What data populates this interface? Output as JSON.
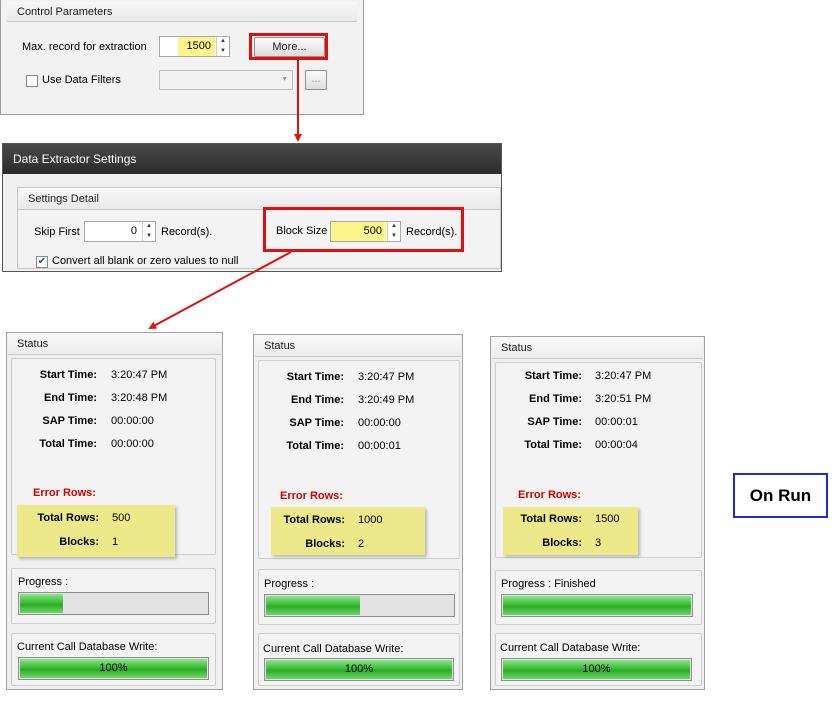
{
  "control_parameters": {
    "header": "Control Parameters",
    "max_record_label": "Max. record for extraction",
    "max_record_value": "1500",
    "more_button": "More...",
    "use_filters_label": "Use Data Filters",
    "use_filters_checked": false,
    "filter_button": "..."
  },
  "data_extractor_settings": {
    "title": "Data Extractor Settings",
    "group_header": "Settings Detail",
    "skip_first_label": "Skip First",
    "skip_first_value": "0",
    "skip_records_label": "Record(s).",
    "block_size_label": "Block Size",
    "block_size_value": "500",
    "block_records_label": "Record(s).",
    "convert_label": "Convert all blank or zero values to null",
    "convert_checked": true
  },
  "status_panels": [
    {
      "header": "Status",
      "start_time_label": "Start Time:",
      "start_time": "3:20:47 PM",
      "end_time_label": "End Time:",
      "end_time": "3:20:48 PM",
      "sap_time_label": "SAP Time:",
      "sap_time": "00:00:00",
      "total_time_label": "Total Time:",
      "total_time": "00:00:00",
      "error_rows_label": "Error Rows:",
      "total_rows_label": "Total Rows:",
      "total_rows": "500",
      "blocks_label": "Blocks:",
      "blocks": "1",
      "progress_label": "Progress :",
      "progress_status": "",
      "progress_fraction": 0.24,
      "db_write_label": "Current Call Database Write:",
      "db_write_value": "100%",
      "db_write_fraction": 1.0
    },
    {
      "header": "Status",
      "start_time_label": "Start Time:",
      "start_time": "3:20:47 PM",
      "end_time_label": "End Time:",
      "end_time": "3:20:49 PM",
      "sap_time_label": "SAP Time:",
      "sap_time": "00:00:00",
      "total_time_label": "Total Time:",
      "total_time": "00:00:01",
      "error_rows_label": "Error Rows:",
      "total_rows_label": "Total Rows:",
      "total_rows": "1000",
      "blocks_label": "Blocks:",
      "blocks": "2",
      "progress_label": "Progress :",
      "progress_status": "",
      "progress_fraction": 0.51,
      "db_write_label": "Current Call Database Write:",
      "db_write_value": "100%",
      "db_write_fraction": 1.0
    },
    {
      "header": "Status",
      "start_time_label": "Start Time:",
      "start_time": "3:20:47 PM",
      "end_time_label": "End Time:",
      "end_time": "3:20:51 PM",
      "sap_time_label": "SAP Time:",
      "sap_time": "00:00:01",
      "total_time_label": "Total Time:",
      "total_time": "00:00:04",
      "error_rows_label": "Error Rows:",
      "total_rows_label": "Total Rows:",
      "total_rows": "1500",
      "blocks_label": "Blocks:",
      "blocks": "3",
      "progress_label": "Progress :",
      "progress_status": "Finished",
      "progress_fraction": 1.0,
      "db_write_label": "Current Call Database Write:",
      "db_write_value": "100%",
      "db_write_fraction": 1.0
    }
  ],
  "annotation": {
    "on_run": "On Run"
  },
  "colors": {
    "highlight_red": "#e01010",
    "highlight_yellow": "#ece98b",
    "error_red": "#d40000",
    "progress_green": "#3bbd35",
    "on_run_border": "#1f2ad6"
  }
}
